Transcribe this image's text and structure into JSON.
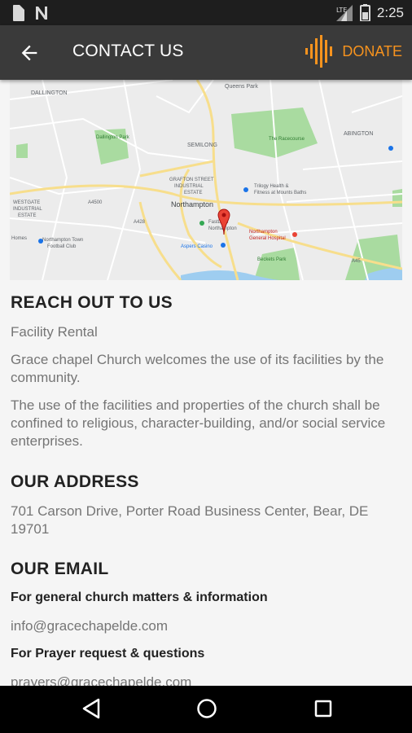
{
  "status_bar": {
    "time": "2:25",
    "icons": [
      "sim-icon",
      "n-notification-icon",
      "signal-icon",
      "battery-icon"
    ]
  },
  "app_bar": {
    "title": "CONTACT US",
    "donate_label": "DONATE",
    "back_icon": "arrow-back-icon",
    "accent_color": "#f7931e"
  },
  "map": {
    "labels": {
      "dallington": "DALLINGTON",
      "queens_park": "Queens Park",
      "dallington_park": "Dallington Park",
      "semilong": "SEMILONG",
      "racecourse": "The Racecourse",
      "abington": "ABINGTON",
      "grafton": "GRAFTON STREET",
      "industrial": "INDUSTRIAL",
      "estate": "ESTATE",
      "northampton": "Northampton",
      "trilogy": "Trilogy Health &",
      "fitness": "Fitness at Mounts Baths",
      "westgate": "WESTGATE",
      "west_industrial": "INDUSTRIAL",
      "west_estate": "ESTATE",
      "homes": "Homes",
      "football": "Northampton Town",
      "football_club": "Football Club",
      "hospital": "Northampton",
      "hospital2": "General Hospital",
      "aspers": "Aspers Casino",
      "beckets": "Beckets Park",
      "fastless": "FastLess",
      "fastless2": "Northampton",
      "road_a4500": "A4500",
      "road_a428": "A428",
      "road_a45": "A45"
    }
  },
  "reach_out": {
    "heading": "REACH OUT TO US",
    "subtitle": "Facility Rental",
    "para1": "Grace chapel Church welcomes the use of its facilities by the community.",
    "para2": "The use of the facilities and properties of the church shall be confined to religious, character-building, and/or social service enterprises."
  },
  "address": {
    "heading": "OUR ADDRESS",
    "text": "701 Carson Drive, Porter Road Business Center, Bear, DE 19701"
  },
  "email": {
    "heading": "OUR EMAIL",
    "general_label": "For general church matters & information",
    "general_email": "info@gracechapelde.com",
    "prayer_label": "For Prayer request & questions",
    "prayer_email": "prayers@gracechapelde.com"
  },
  "nav_bar": {
    "icons": [
      "back-triangle-icon",
      "home-circle-icon",
      "recents-square-icon"
    ]
  }
}
